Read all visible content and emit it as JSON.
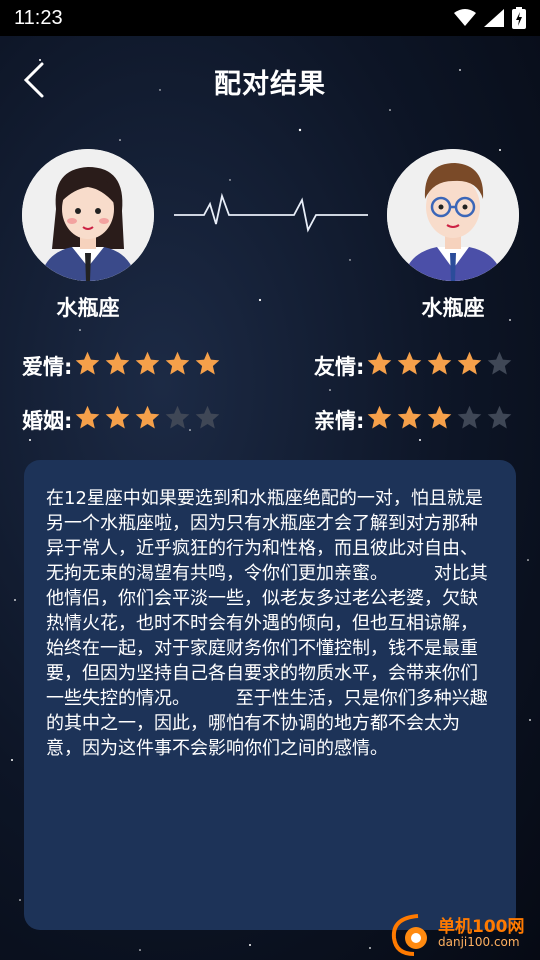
{
  "status_bar": {
    "time": "11:23",
    "icons": [
      "wifi-icon",
      "signal-icon",
      "battery-charging-icon"
    ]
  },
  "header": {
    "back_icon": "chevron-left-icon",
    "title": "配对结果"
  },
  "left_person": {
    "avatar": "female-avatar",
    "sign": "水瓶座"
  },
  "right_person": {
    "avatar": "male-avatar",
    "sign": "水瓶座"
  },
  "ratings": [
    {
      "label": "爱情:",
      "stars": 5,
      "max": 5
    },
    {
      "label": "友情:",
      "stars": 4,
      "max": 5
    },
    {
      "label": "婚姻:",
      "stars": 3,
      "max": 5
    },
    {
      "label": "亲情:",
      "stars": 3,
      "max": 5
    }
  ],
  "description": "在12星座中如果要选到和水瓶座绝配的一对，怕且就是另一个水瓶座啦，因为只有水瓶座才会了解到对方那种异于常人，近乎疯狂的行为和性格，而且彼此对自由、无拘无束的渴望有共鸣，令你们更加亲蜜。        对比其他情侣，你们会平淡一些，似老友多过老公老婆，欠缺热情火花，也时不时会有外遇的倾向，但也互相谅解，始终在一起，对于家庭财务你们不懂控制，钱不是最重要，但因为坚持自己各自要求的物质水平，会带来你们一些失控的情况。        至于性生活，只是你们多种兴趣的其中之一，因此，哪怕有不协调的地方都不会太为意，因为这件事不会影响你们之间的感情。",
  "watermark": {
    "brand": "单机100网",
    "url": "danji100.com"
  },
  "colors": {
    "star_filled": "#f5a04a",
    "star_empty": "#3f4756",
    "card_bg": "#1d3358"
  }
}
